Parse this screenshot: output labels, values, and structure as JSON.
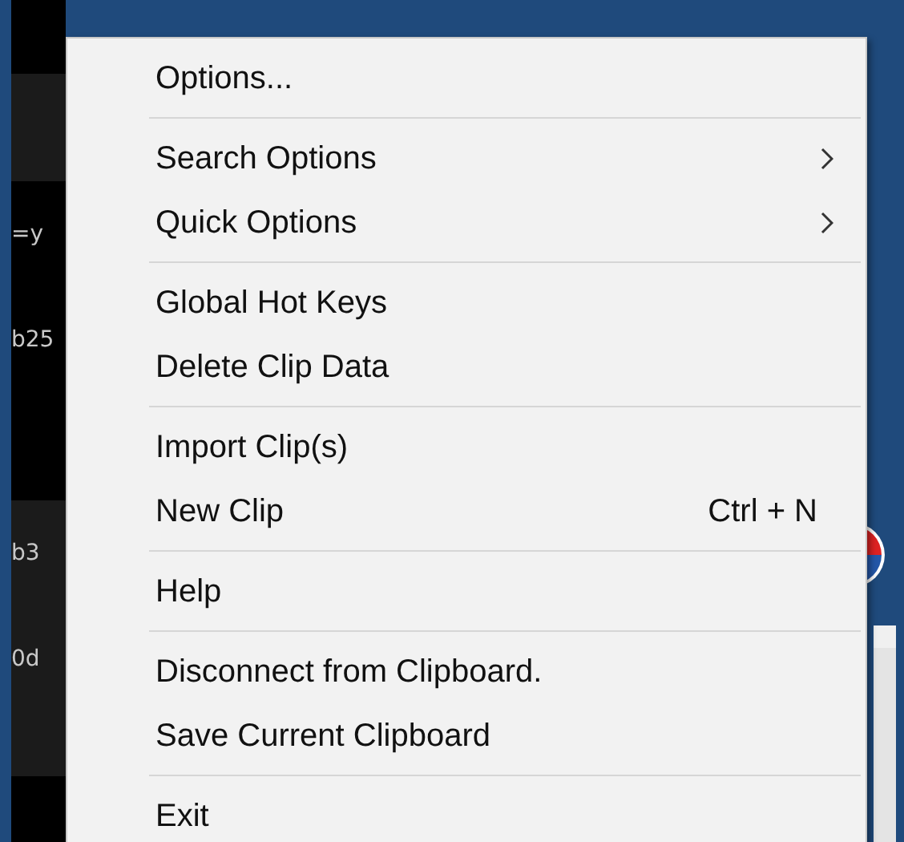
{
  "background_list": {
    "rows": [
      {
        "text": "=y"
      },
      {
        "text": "b25"
      },
      {
        "text": "b3"
      },
      {
        "text": "0d"
      }
    ]
  },
  "context_menu": {
    "groups": [
      [
        {
          "label": "Options..."
        }
      ],
      [
        {
          "label": "Search Options",
          "has_submenu": true
        },
        {
          "label": "Quick Options",
          "has_submenu": true
        }
      ],
      [
        {
          "label": "Global Hot Keys"
        },
        {
          "label": "Delete Clip Data"
        }
      ],
      [
        {
          "label": "Import Clip(s)"
        },
        {
          "label": "New Clip",
          "shortcut": "Ctrl + N"
        }
      ],
      [
        {
          "label": "Help"
        }
      ],
      [
        {
          "label": "Disconnect from Clipboard."
        },
        {
          "label": "Save Current Clipboard"
        }
      ],
      [
        {
          "label": "Exit"
        }
      ]
    ]
  }
}
